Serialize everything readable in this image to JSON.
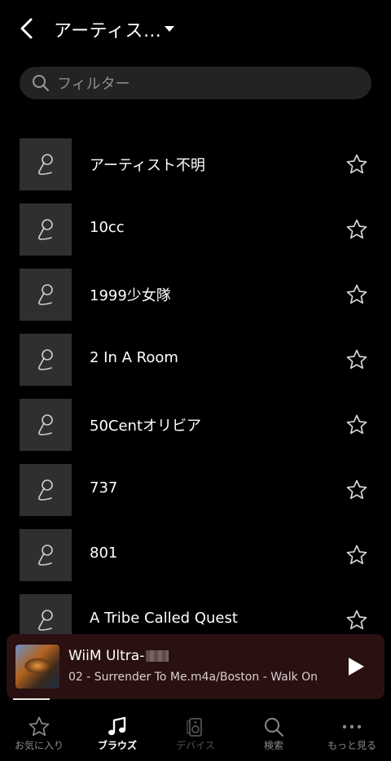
{
  "header": {
    "title": "アーティス…"
  },
  "search": {
    "placeholder": "フィルター"
  },
  "artists": [
    {
      "name": "アーティスト不明"
    },
    {
      "name": "10cc"
    },
    {
      "name": "1999少女隊"
    },
    {
      "name": "2 In A Room"
    },
    {
      "name": "50Centオリビア"
    },
    {
      "name": "737"
    },
    {
      "name": "801"
    },
    {
      "name": "A Tribe Called Quest"
    }
  ],
  "mini_player": {
    "device": "WiiM Ultra-",
    "track": "02 - Surrender To Me.m4a/Boston - Walk On",
    "progress": 0.1
  },
  "tabs": [
    {
      "label": "お気に入り",
      "icon": "star-icon"
    },
    {
      "label": "ブラウズ",
      "icon": "music-note-icon"
    },
    {
      "label": "デバイス",
      "icon": "speaker-icon"
    },
    {
      "label": "検索",
      "icon": "search-icon"
    },
    {
      "label": "もっと見る",
      "icon": "more-icon"
    }
  ],
  "active_tab": "ブラウズ"
}
